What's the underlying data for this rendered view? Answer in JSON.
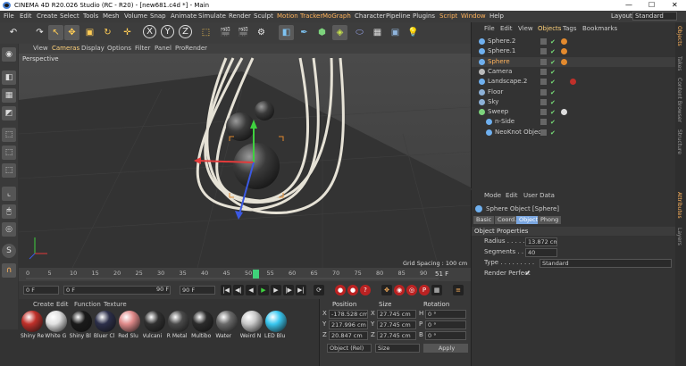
{
  "window": {
    "title": "CINEMA 4D R20.026 Studio (RC - R20) - [new681.c4d *] - Main"
  },
  "menu": {
    "items": [
      "File",
      "Edit",
      "Create",
      "Select",
      "Tools",
      "Mesh",
      "Volume",
      "Snap",
      "Animate",
      "Simulate",
      "Render",
      "Sculpt",
      "Motion Tracker",
      "MoGraph",
      "Character",
      "Pipeline",
      "Plugins",
      "Script",
      "Window",
      "Help"
    ],
    "layout_label": "Layout:",
    "layout_value": "Standard"
  },
  "viewport": {
    "menu": [
      "View",
      "Cameras",
      "Display",
      "Options",
      "Filter",
      "Panel",
      "ProRender"
    ],
    "label": "Perspective",
    "grid_spacing": "Grid Spacing : 100 cm"
  },
  "timeline": {
    "ticks": [
      "0",
      "5",
      "10",
      "15",
      "20",
      "25",
      "30",
      "35",
      "40",
      "45",
      "50",
      "55",
      "60",
      "65",
      "70",
      "75",
      "80",
      "85",
      "90"
    ],
    "current_frame": "51",
    "end_label": "51 F",
    "frame_start": "0 F",
    "frame_current": "0 F",
    "frame_end_a": "90 F",
    "frame_end_b": "90 F"
  },
  "materials": {
    "menu": [
      "Create",
      "Edit",
      "Function",
      "Texture"
    ],
    "items": [
      {
        "label": "Shiny Re",
        "color": "#c0302a"
      },
      {
        "label": "White G",
        "color": "#e0e0e0"
      },
      {
        "label": "Shiny Bl",
        "color": "#1a1a1a"
      },
      {
        "label": "Bluer Cl",
        "color": "#2c2f4a"
      },
      {
        "label": "Red Slu",
        "color": "#e08a8a"
      },
      {
        "label": "Vulcani",
        "color": "#303030"
      },
      {
        "label": "R Metal",
        "color": "#4a4a4a"
      },
      {
        "label": "Multibo",
        "color": "#2b2b2b"
      },
      {
        "label": "Water",
        "color": "#6a6a6a"
      },
      {
        "label": "Weird N",
        "color": "#c9c9c9"
      },
      {
        "label": "LED Blu",
        "color": "#39c7f0"
      }
    ]
  },
  "coords": {
    "headers": [
      "Position",
      "Size",
      "Rotation"
    ],
    "rows": [
      {
        "axis": "X",
        "pos": "-178.528 cm",
        "sizeaxis": "X",
        "size": "27.745 cm",
        "rotaxis": "H",
        "rot": "0 °"
      },
      {
        "axis": "Y",
        "pos": "217.996 cm",
        "sizeaxis": "Y",
        "size": "27.745 cm",
        "rotaxis": "P",
        "rot": "0 °"
      },
      {
        "axis": "Z",
        "pos": "20.847 cm",
        "sizeaxis": "Z",
        "size": "27.745 cm",
        "rotaxis": "B",
        "rot": "0 °"
      }
    ],
    "mode": "Object (Rel)",
    "size_mode": "Size",
    "apply": "Apply"
  },
  "objects": {
    "menu": [
      "File",
      "Edit",
      "View",
      "Objects",
      "Tags",
      "Bookmarks"
    ],
    "rows": [
      {
        "name": "Sphere.2",
        "icon_color": "#6fb0ef",
        "indent": 0
      },
      {
        "name": "Sphere.1",
        "icon_color": "#6fb0ef",
        "indent": 0
      },
      {
        "name": "Sphere",
        "icon_color": "#6fb0ef",
        "indent": 0,
        "selected": true
      },
      {
        "name": "Camera",
        "icon_color": "#bbbbbb",
        "indent": 0
      },
      {
        "name": "Landscape.2",
        "icon_color": "#6fb0ef",
        "indent": 0
      },
      {
        "name": "Floor",
        "icon_color": "#8db1d8",
        "indent": 0
      },
      {
        "name": "Sky",
        "icon_color": "#8db1d8",
        "indent": 0
      },
      {
        "name": "Sweep",
        "icon_color": "#7dd37d",
        "indent": 0
      },
      {
        "name": "n-Side",
        "icon_color": "#6fb0ef",
        "indent": 1
      },
      {
        "name": "NeoKnot Object",
        "icon_color": "#6fb0ef",
        "indent": 1
      }
    ]
  },
  "attributes": {
    "menu": [
      "Mode",
      "Edit",
      "User Data"
    ],
    "object_title": "Sphere Object [Sphere]",
    "tabs": [
      "Basic",
      "Coord.",
      "Object",
      "Phong"
    ],
    "active_tab": "Object",
    "section": "Object Properties",
    "radius_label": "Radius . . . . . . .",
    "radius_value": "13.872 cm",
    "segments_label": "Segments . . . .",
    "segments_value": "40",
    "type_label": "Type . . . . . . . . .",
    "type_value": "Standard",
    "render_perfect_label": "Render Perfect",
    "render_perfect_checked": "✔"
  },
  "side_tabs": [
    "Objects",
    "Takes",
    "Content Browser",
    "Structure",
    "Attributes",
    "Layers"
  ]
}
